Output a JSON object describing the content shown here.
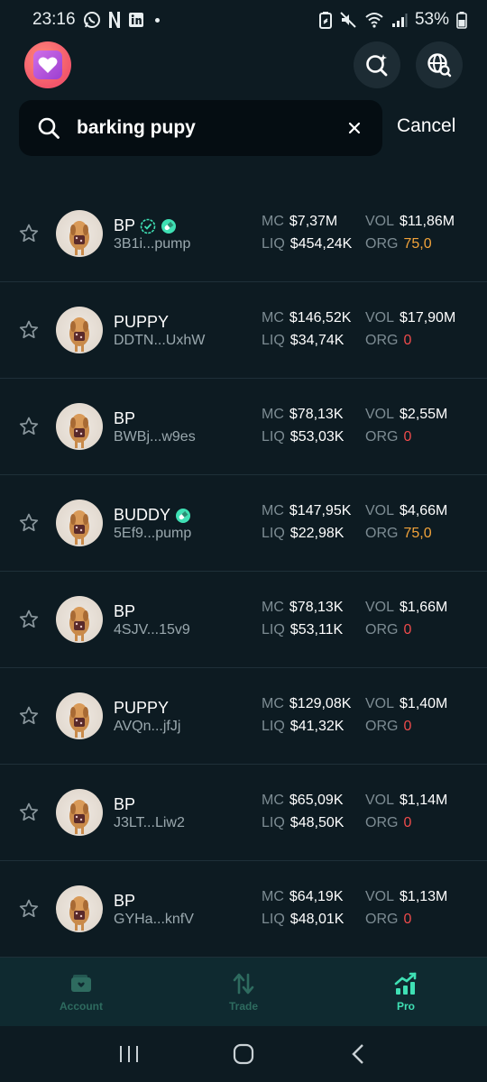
{
  "status_bar": {
    "time": "23:16",
    "battery": "53%",
    "icons": [
      "whatsapp-icon",
      "netflix-icon",
      "linkedin-icon",
      "dot-icon",
      "battery-saver-icon",
      "mute-icon",
      "wifi-icon",
      "signal-icon",
      "battery-icon"
    ]
  },
  "header": {
    "logo_icon": "heart-icon",
    "buttons": [
      "search-sparkle-icon",
      "globe-search-icon"
    ]
  },
  "search": {
    "value": "barking pupy",
    "cancel_label": "Cancel"
  },
  "labels": {
    "mc": "MC",
    "liq": "LIQ",
    "vol": "VOL",
    "org": "ORG"
  },
  "tokens": [
    {
      "name": "BP",
      "addr": "3B1i...pump",
      "mc": "$7,37M",
      "liq": "$454,24K",
      "vol": "$11,86M",
      "org": "75,0",
      "org_color": "orange",
      "badges": [
        "verified-icon",
        "pill-icon"
      ]
    },
    {
      "name": "PUPPY",
      "addr": "DDTN...UxhW",
      "mc": "$146,52K",
      "liq": "$34,74K",
      "vol": "$17,90M",
      "org": "0",
      "org_color": "red",
      "badges": []
    },
    {
      "name": "BP",
      "addr": "BWBj...w9es",
      "mc": "$78,13K",
      "liq": "$53,03K",
      "vol": "$2,55M",
      "org": "0",
      "org_color": "red",
      "badges": []
    },
    {
      "name": "BUDDY",
      "addr": "5Ef9...pump",
      "mc": "$147,95K",
      "liq": "$22,98K",
      "vol": "$4,66M",
      "org": "75,0",
      "org_color": "orange",
      "badges": [
        "pill-icon"
      ]
    },
    {
      "name": "BP",
      "addr": "4SJV...15v9",
      "mc": "$78,13K",
      "liq": "$53,11K",
      "vol": "$1,66M",
      "org": "0",
      "org_color": "red",
      "badges": []
    },
    {
      "name": "PUPPY",
      "addr": "AVQn...jfJj",
      "mc": "$129,08K",
      "liq": "$41,32K",
      "vol": "$1,40M",
      "org": "0",
      "org_color": "red",
      "badges": []
    },
    {
      "name": "BP",
      "addr": "J3LT...Liw2",
      "mc": "$65,09K",
      "liq": "$48,50K",
      "vol": "$1,14M",
      "org": "0",
      "org_color": "red",
      "badges": []
    },
    {
      "name": "BP",
      "addr": "GYHa...knfV",
      "mc": "$64,19K",
      "liq": "$48,01K",
      "vol": "$1,13M",
      "org": "0",
      "org_color": "red",
      "badges": []
    }
  ],
  "bottom_nav": [
    {
      "label": "Account",
      "icon": "wallet-icon",
      "active": false
    },
    {
      "label": "Trade",
      "icon": "swap-arrows-icon",
      "active": false
    },
    {
      "label": "Pro",
      "icon": "chart-icon",
      "active": true
    }
  ],
  "colors": {
    "background": "#0d1b22",
    "accent": "#3fe0b4",
    "orange": "#f2a33a",
    "red": "#ef4b4b"
  }
}
